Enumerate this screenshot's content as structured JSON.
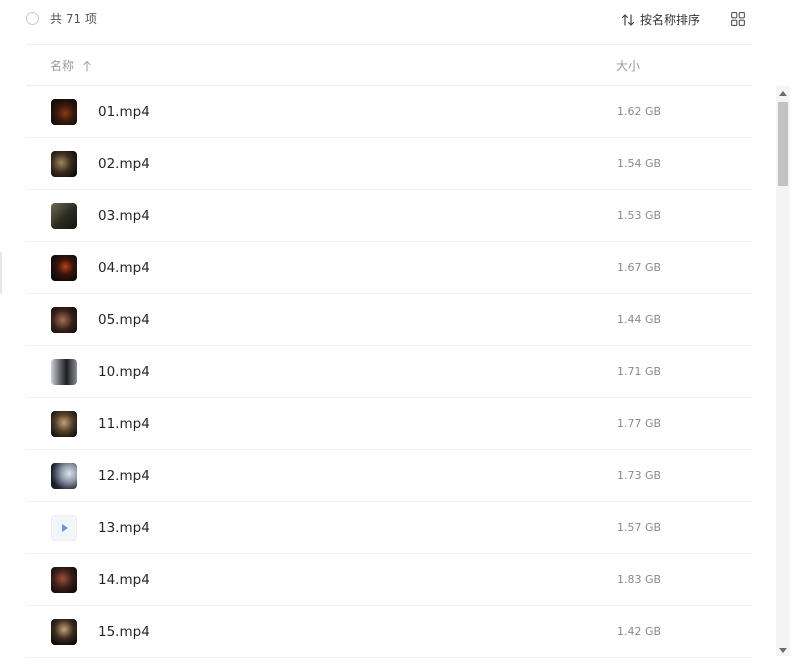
{
  "toolbar": {
    "count_label": "共 71 项",
    "sort_label": "按名称排序",
    "sort_icon": "swap-vertical-icon",
    "view_icon": "grid-view-icon"
  },
  "table": {
    "name_header": "名称",
    "size_header": "大小",
    "sort_direction_icon": "arrow-up-icon"
  },
  "files": [
    {
      "name": "01.mp4",
      "size": "1.62 GB",
      "thumbnail": "video-frame"
    },
    {
      "name": "02.mp4",
      "size": "1.54 GB",
      "thumbnail": "video-frame"
    },
    {
      "name": "03.mp4",
      "size": "1.53 GB",
      "thumbnail": "video-frame"
    },
    {
      "name": "04.mp4",
      "size": "1.67 GB",
      "thumbnail": "video-frame"
    },
    {
      "name": "05.mp4",
      "size": "1.44 GB",
      "thumbnail": "video-frame"
    },
    {
      "name": "10.mp4",
      "size": "1.71 GB",
      "thumbnail": "video-frame"
    },
    {
      "name": "11.mp4",
      "size": "1.77 GB",
      "thumbnail": "video-frame"
    },
    {
      "name": "12.mp4",
      "size": "1.73 GB",
      "thumbnail": "video-frame"
    },
    {
      "name": "13.mp4",
      "size": "1.57 GB",
      "thumbnail": "generic-video-icon"
    },
    {
      "name": "14.mp4",
      "size": "1.83 GB",
      "thumbnail": "video-frame"
    },
    {
      "name": "15.mp4",
      "size": "1.42 GB",
      "thumbnail": "video-frame"
    }
  ],
  "colors": {
    "text_primary": "#262626",
    "text_secondary": "#8a8a8a",
    "divider": "#f0f0f0",
    "video_icon_accent": "#6f8ef0"
  }
}
